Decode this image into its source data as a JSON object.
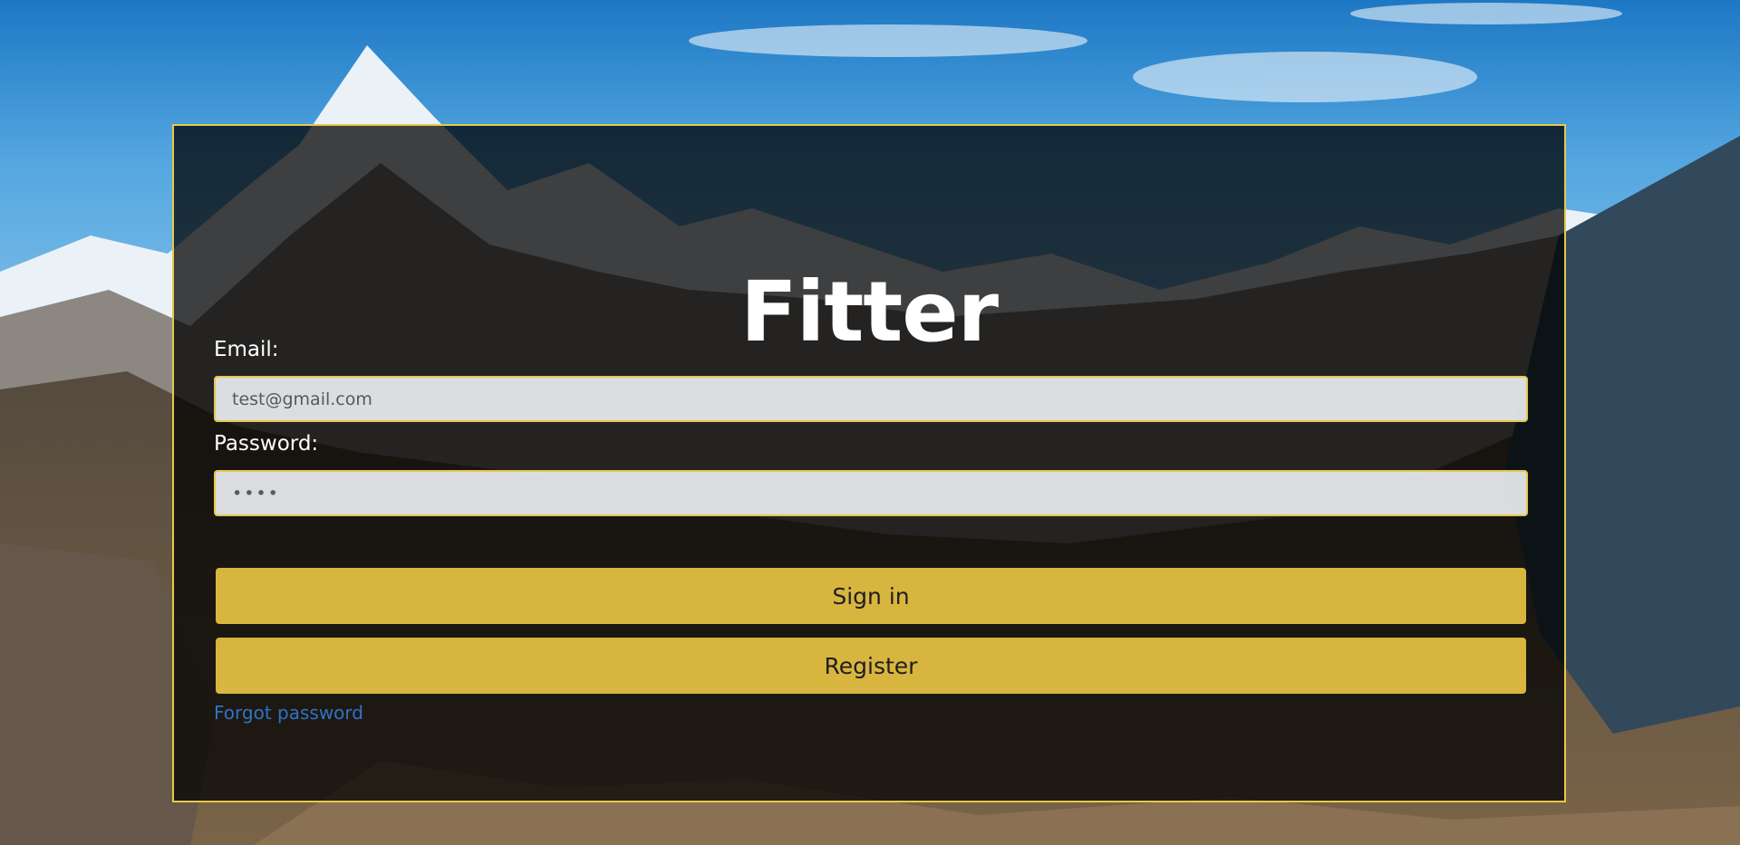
{
  "app": {
    "title": "Fitter"
  },
  "form": {
    "email": {
      "label": "Email:",
      "value": "test@gmail.com"
    },
    "password": {
      "label": "Password:",
      "masked_value": "••••"
    },
    "buttons": {
      "sign_in": "Sign in",
      "register": "Register"
    },
    "forgot_password": "Forgot password"
  },
  "colors": {
    "accent_yellow": "#e6c84a",
    "button_yellow": "#f2cc46",
    "link_blue": "#2f73c7",
    "panel_overlay": "#000000"
  },
  "icons": {
    "background": "mountain-landscape"
  }
}
